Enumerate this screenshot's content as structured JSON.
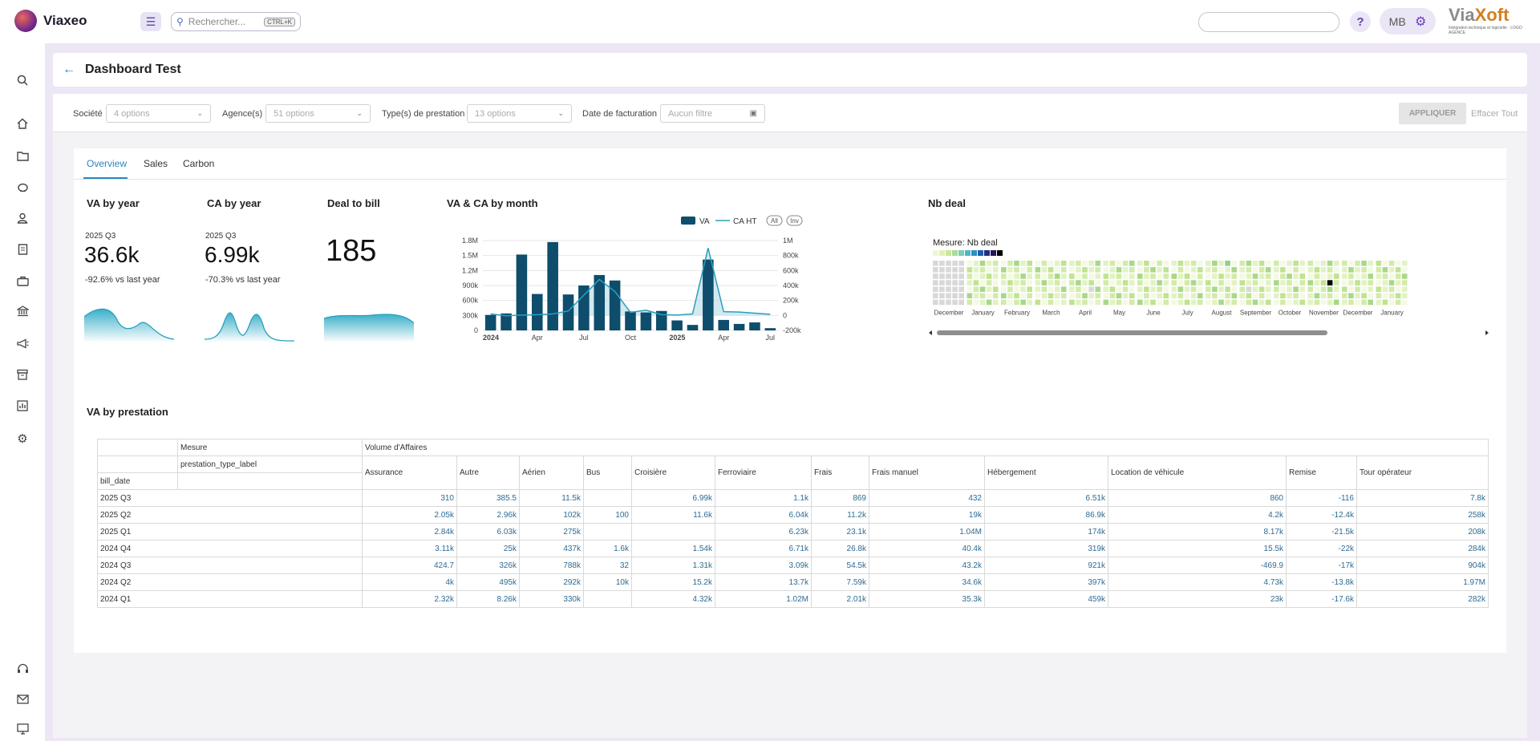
{
  "app": {
    "name": "Viaxeo",
    "search_placeholder": "Rechercher...",
    "search_shortcut": "CTRL+K",
    "user_initials": "MB",
    "help_label": "?",
    "brand_name_a": "Via",
    "brand_name_b": "Xoft",
    "brand_tagline": "Intégration technique et logicielle · LOGO AGENCE"
  },
  "sidebar": {
    "icons": [
      "search-icon",
      "home-icon",
      "folder-icon",
      "piggy-bank-icon",
      "user-icon",
      "document-icon",
      "briefcase-icon",
      "bank-icon",
      "megaphone-icon",
      "archive-icon",
      "bar-chart-icon",
      "settings-icon",
      "headset-icon",
      "mail-icon",
      "monitor-icon"
    ]
  },
  "page": {
    "back_icon": "arrow-left-icon",
    "title": "Dashboard Test"
  },
  "filters": {
    "societe_label": "Société",
    "societe_value": "4 options",
    "agences_label": "Agence(s)",
    "agences_value": "51 options",
    "types_label": "Type(s) de prestation",
    "types_value": "13 options",
    "date_label": "Date de facturation",
    "date_value": "Aucun filtre",
    "apply_label": "APPLIQUER",
    "clear_label": "Effacer Tout"
  },
  "tabs": [
    {
      "label": "Overview",
      "active": true
    },
    {
      "label": "Sales",
      "active": false
    },
    {
      "label": "Carbon",
      "active": false
    }
  ],
  "kpis": {
    "va_by_year": {
      "title": "VA by year",
      "period": "2025 Q3",
      "value": "36.6k",
      "delta": "-92.6% vs last year"
    },
    "ca_by_year": {
      "title": "CA by year",
      "period": "2025 Q3",
      "value": "6.99k",
      "delta": "-70.3% vs last year"
    },
    "deal_to_bill": {
      "title": "Deal to bill",
      "value": "185"
    }
  },
  "chart_data": [
    {
      "type": "bar",
      "title": "VA & CA by month",
      "legend": [
        "VA",
        "CA HT"
      ],
      "legend_buttons": [
        "All",
        "Inv"
      ],
      "x_tick_labels": [
        "2024",
        "Apr",
        "Jul",
        "Oct",
        "2025",
        "Apr",
        "Jul"
      ],
      "y_left_ticks": [
        "0",
        "300k",
        "600k",
        "900k",
        "1.2M",
        "1.5M",
        "1.8M"
      ],
      "y_right_ticks": [
        "-200k",
        "0",
        "200k",
        "400k",
        "600k",
        "800k",
        "1M"
      ],
      "ylim_left": [
        0,
        1800000
      ],
      "ylim_right": [
        -200000,
        1000000
      ],
      "categories": [
        "2024-01",
        "2024-02",
        "2024-03",
        "2024-04",
        "2024-05",
        "2024-06",
        "2024-07",
        "2024-08",
        "2024-09",
        "2024-10",
        "2024-11",
        "2024-12",
        "2025-01",
        "2025-02",
        "2025-03",
        "2025-04",
        "2025-05",
        "2025-06",
        "2025-07"
      ],
      "series": [
        {
          "name": "VA",
          "kind": "bar",
          "values": [
            310000,
            340000,
            1520000,
            730000,
            1770000,
            720000,
            900000,
            1110000,
            1000000,
            380000,
            360000,
            390000,
            200000,
            110000,
            1420000,
            210000,
            130000,
            160000,
            45000
          ]
        },
        {
          "name": "CA HT",
          "kind": "line",
          "axis": "right",
          "values": [
            20000,
            -5000,
            5000,
            10000,
            20000,
            60000,
            270000,
            480000,
            320000,
            40000,
            70000,
            10000,
            5000,
            20000,
            900000,
            50000,
            45000,
            30000,
            15000
          ]
        }
      ]
    },
    {
      "type": "heatmap",
      "title": "Nb deal",
      "legend_title": "Mesure: Nb deal",
      "x_tick_labels": [
        "December",
        "January",
        "February",
        "March",
        "April",
        "May",
        "June",
        "July",
        "August",
        "September",
        "October",
        "November",
        "December",
        "January"
      ]
    }
  ],
  "table": {
    "title": "VA by prestation",
    "measure_label": "Mesure",
    "measure_value": "Volume d'Affaires",
    "column_dim": "prestation_type_label",
    "row_dim": "bill_date",
    "columns": [
      "Assurance",
      "Autre",
      "Aérien",
      "Bus",
      "Croisière",
      "Ferroviaire",
      "Frais",
      "Frais manuel",
      "Hébergement",
      "Location de véhicule",
      "Remise",
      "Tour opérateur"
    ],
    "rows": [
      {
        "label": "2025 Q3",
        "values": [
          "310",
          "385.5",
          "11.5k",
          "",
          "6.99k",
          "1.1k",
          "869",
          "432",
          "6.51k",
          "860",
          "-116",
          "7.8k"
        ]
      },
      {
        "label": "2025 Q2",
        "values": [
          "2.05k",
          "2.96k",
          "102k",
          "100",
          "11.6k",
          "6.04k",
          "11.2k",
          "19k",
          "86.9k",
          "4.2k",
          "-12.4k",
          "258k"
        ]
      },
      {
        "label": "2025 Q1",
        "values": [
          "2.84k",
          "6.03k",
          "275k",
          "",
          "",
          "6.23k",
          "23.1k",
          "1.04M",
          "174k",
          "8.17k",
          "-21.5k",
          "208k"
        ]
      },
      {
        "label": "2024 Q4",
        "values": [
          "3.11k",
          "25k",
          "437k",
          "1.6k",
          "1.54k",
          "6.71k",
          "26.8k",
          "40.4k",
          "319k",
          "15.5k",
          "-22k",
          "284k"
        ]
      },
      {
        "label": "2024 Q3",
        "values": [
          "424.7",
          "326k",
          "788k",
          "32",
          "1.31k",
          "3.09k",
          "54.5k",
          "43.2k",
          "921k",
          "-469.9",
          "-17k",
          "904k"
        ]
      },
      {
        "label": "2024 Q2",
        "values": [
          "4k",
          "495k",
          "292k",
          "10k",
          "15.2k",
          "13.7k",
          "7.59k",
          "34.6k",
          "397k",
          "4.73k",
          "-13.8k",
          "1.97M"
        ]
      },
      {
        "label": "2024 Q1",
        "values": [
          "2.32k",
          "8.26k",
          "330k",
          "",
          "4.32k",
          "1.02M",
          "2.01k",
          "35.3k",
          "459k",
          "23k",
          "-17.6k",
          "282k"
        ]
      }
    ]
  }
}
